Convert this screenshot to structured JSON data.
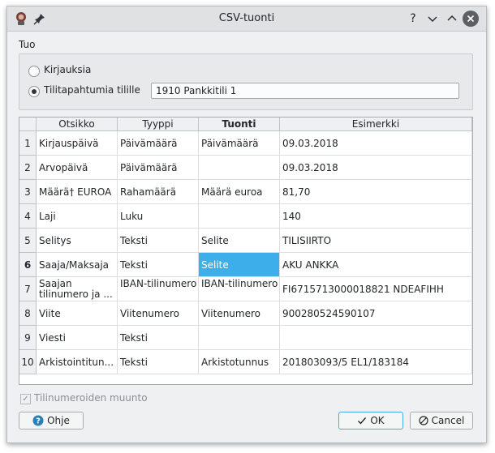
{
  "window": {
    "title": "CSV-tuonti"
  },
  "titlebar": {
    "help_glyph": "?",
    "min_glyph": "⌄",
    "max_glyph": "⌃",
    "close_glyph": "✕"
  },
  "import_group": {
    "title": "Tuo",
    "option_entries": "Kirjauksia",
    "option_transactions": "Tilitapahtumia tilille",
    "selected_option": "option_transactions",
    "account_value": "1910 Pankkitili 1"
  },
  "table": {
    "headers": {
      "otsikko": "Otsikko",
      "tyyppi": "Tyyppi",
      "tuonti": "Tuonti",
      "esimerkki": "Esimerkki"
    },
    "rows": [
      {
        "num": "1",
        "otsikko": "Kirjauspäivä",
        "tyyppi": "Päivämäärä",
        "tuonti": "Päivämäärä",
        "esimerkki": "09.03.2018"
      },
      {
        "num": "2",
        "otsikko": "Arvopäivä",
        "tyyppi": "Päivämäärä",
        "tuonti": "",
        "esimerkki": "09.03.2018"
      },
      {
        "num": "3",
        "otsikko": "Määrä† EUROA",
        "tyyppi": "Rahamäärä",
        "tuonti": "Määrä euroa",
        "esimerkki": "81,70"
      },
      {
        "num": "4",
        "otsikko": "Laji",
        "tyyppi": "Luku",
        "tuonti": "",
        "esimerkki": "140"
      },
      {
        "num": "5",
        "otsikko": "Selitys",
        "tyyppi": "Teksti",
        "tuonti": "Selite",
        "esimerkki": "TILISIIRTO"
      },
      {
        "num": "6",
        "otsikko": "Saaja/Maksaja",
        "tyyppi": "Teksti",
        "tuonti": "Selite",
        "esimerkki": "AKU ANKKA"
      },
      {
        "num": "7",
        "otsikko": "Saajan tilinumero ja ...",
        "tyyppi": "IBAN-tilinumero",
        "tuonti": "IBAN-tilinumero",
        "esimerkki": "FI6715713000018821 NDEAFIHH"
      },
      {
        "num": "8",
        "otsikko": "Viite",
        "tyyppi": "Viitenumero",
        "tuonti": "Viitenumero",
        "esimerkki": "900280524590107"
      },
      {
        "num": "9",
        "otsikko": "Viesti",
        "tyyppi": "Teksti",
        "tuonti": "",
        "esimerkki": ""
      },
      {
        "num": "10",
        "otsikko": "Arkistointitun...",
        "tyyppi": "Teksti",
        "tuonti": "Arkistotunnus",
        "esimerkki": "201803093/5  EL1/183184"
      }
    ]
  },
  "options": {
    "convert_account_numbers": "Tilinumeroiden muunto",
    "checked": true
  },
  "buttons": {
    "help": "Ohje",
    "ok": "OK",
    "cancel": "Cancel"
  },
  "colors": {
    "selection": "#3daee9",
    "window_bg": "#eff0f1"
  }
}
